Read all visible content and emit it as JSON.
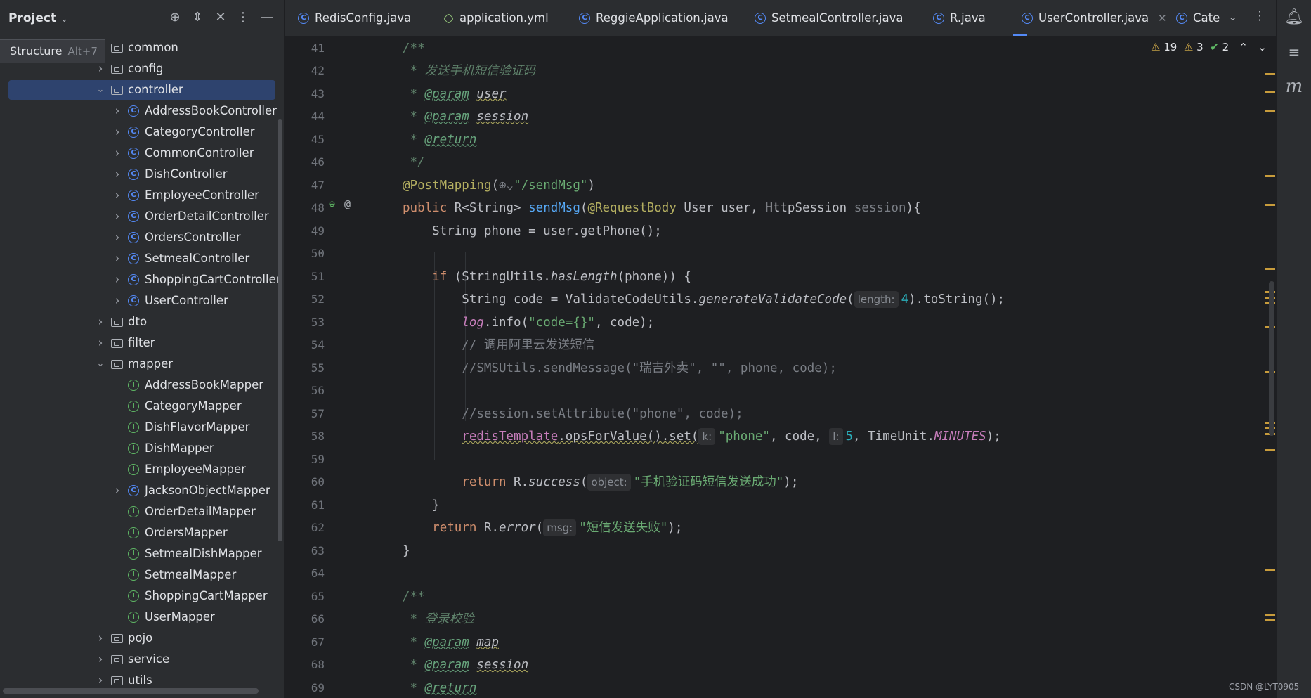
{
  "project_panel": {
    "title": "Project",
    "tooltip": {
      "label": "Structure",
      "shortcut": "Alt+7"
    },
    "tree": [
      {
        "label": "common",
        "icon": "folder-icon",
        "level": 1,
        "expander": ""
      },
      {
        "label": "config",
        "icon": "folder-icon",
        "level": 1,
        "expander": "collapsed"
      },
      {
        "label": "controller",
        "icon": "folder-icon",
        "level": 1,
        "expander": "expanded",
        "selected": true
      },
      {
        "label": "AddressBookController",
        "icon": "class-icon",
        "level": 2,
        "expander": "collapsed"
      },
      {
        "label": "CategoryController",
        "icon": "class-icon",
        "level": 2,
        "expander": "collapsed"
      },
      {
        "label": "CommonController",
        "icon": "class-icon",
        "level": 2,
        "expander": "collapsed"
      },
      {
        "label": "DishController",
        "icon": "class-icon",
        "level": 2,
        "expander": "collapsed"
      },
      {
        "label": "EmployeeController",
        "icon": "class-icon",
        "level": 2,
        "expander": "collapsed"
      },
      {
        "label": "OrderDetailController",
        "icon": "class-icon",
        "level": 2,
        "expander": "collapsed"
      },
      {
        "label": "OrdersController",
        "icon": "class-icon",
        "level": 2,
        "expander": "collapsed"
      },
      {
        "label": "SetmealController",
        "icon": "class-icon",
        "level": 2,
        "expander": "collapsed"
      },
      {
        "label": "ShoppingCartController",
        "icon": "class-icon",
        "level": 2,
        "expander": "collapsed"
      },
      {
        "label": "UserController",
        "icon": "class-icon",
        "level": 2,
        "expander": "collapsed"
      },
      {
        "label": "dto",
        "icon": "folder-icon",
        "level": 1,
        "expander": "collapsed"
      },
      {
        "label": "filter",
        "icon": "folder-icon",
        "level": 1,
        "expander": "collapsed"
      },
      {
        "label": "mapper",
        "icon": "folder-icon",
        "level": 1,
        "expander": "expanded"
      },
      {
        "label": "AddressBookMapper",
        "icon": "interface-icon",
        "level": 2,
        "expander": ""
      },
      {
        "label": "CategoryMapper",
        "icon": "interface-icon",
        "level": 2,
        "expander": ""
      },
      {
        "label": "DishFlavorMapper",
        "icon": "interface-icon",
        "level": 2,
        "expander": ""
      },
      {
        "label": "DishMapper",
        "icon": "interface-icon",
        "level": 2,
        "expander": ""
      },
      {
        "label": "EmployeeMapper",
        "icon": "interface-icon",
        "level": 2,
        "expander": ""
      },
      {
        "label": "JacksonObjectMapper",
        "icon": "class-icon",
        "level": 2,
        "expander": "collapsed"
      },
      {
        "label": "OrderDetailMapper",
        "icon": "interface-icon",
        "level": 2,
        "expander": ""
      },
      {
        "label": "OrdersMapper",
        "icon": "interface-icon",
        "level": 2,
        "expander": ""
      },
      {
        "label": "SetmealDishMapper",
        "icon": "interface-icon",
        "level": 2,
        "expander": ""
      },
      {
        "label": "SetmealMapper",
        "icon": "interface-icon",
        "level": 2,
        "expander": ""
      },
      {
        "label": "ShoppingCartMapper",
        "icon": "interface-icon",
        "level": 2,
        "expander": ""
      },
      {
        "label": "UserMapper",
        "icon": "interface-icon",
        "level": 2,
        "expander": ""
      },
      {
        "label": "pojo",
        "icon": "folder-icon",
        "level": 1,
        "expander": "collapsed"
      },
      {
        "label": "service",
        "icon": "folder-icon",
        "level": 1,
        "expander": "collapsed"
      },
      {
        "label": "utils",
        "icon": "folder-icon",
        "level": 1,
        "expander": "collapsed"
      }
    ]
  },
  "tabs": [
    {
      "label": "RedisConfig.java",
      "icon": "class-icon",
      "active": false
    },
    {
      "label": "application.yml",
      "icon": "yaml-icon",
      "active": false
    },
    {
      "label": "ReggieApplication.java",
      "icon": "class-icon",
      "active": false
    },
    {
      "label": "SetmealController.java",
      "icon": "class-icon",
      "active": false
    },
    {
      "label": "R.java",
      "icon": "class-icon",
      "active": false
    },
    {
      "label": "UserController.java",
      "icon": "class-icon",
      "active": true
    },
    {
      "label": "Cate",
      "icon": "class-icon",
      "active": false
    }
  ],
  "inspections": {
    "warnings": "19",
    "weak_warnings": "3",
    "ok": "2"
  },
  "code_lines": [
    {
      "n": "41",
      "html": "<span class='doc'>/**</span>"
    },
    {
      "n": "42",
      "html": "<span class='doc'> * 发送手机短信验证码</span>"
    },
    {
      "n": "43",
      "html": "<span class='doc'> * <span class='doctag'>@param</span> <span class='dparam'>user</span></span>"
    },
    {
      "n": "44",
      "html": "<span class='doc'> * <span class='doctag'>@param</span> <span class='dparam'>session</span></span>"
    },
    {
      "n": "45",
      "html": "<span class='doc'> * <span class='doctag'>@return</span></span>"
    },
    {
      "n": "46",
      "html": "<span class='doc'> */</span>"
    },
    {
      "n": "47",
      "html": "<span class='ann'>@PostMapping</span>(<span class='gray'>⊕⌄</span><span class='str'>\"/<u>sendMsg</u>\"</span>)"
    },
    {
      "n": "48",
      "html": "<span class='kw'>public</span> R&lt;String&gt; <span class='fn'>sendMsg</span>(<span class='ann'>@RequestBody</span> User user, HttpSession <span class='gray'>session</span>){"
    },
    {
      "n": "49",
      "html": "    String phone = user.getPhone();"
    },
    {
      "n": "50",
      "html": ""
    },
    {
      "n": "51",
      "html": "    <span class='kw'>if</span> (StringUtils.<span class='ital'>hasLength</span>(phone)) {"
    },
    {
      "n": "52",
      "html": "        String code = ValidateCodeUtils.<span class='ital'>generateValidateCode</span>(<span class='hint'>length:</span><span class='num'>4</span>).toString();"
    },
    {
      "n": "53",
      "html": "        <span class='field'>log</span>.info(<span class='str'>\"code={}\"</span>, code);"
    },
    {
      "n": "54",
      "html": "        <span class='cmt'>// 调用阿里云发送短信</span>"
    },
    {
      "n": "55",
      "html": "        <span class='cmt'><u>//</u>SMSUtils.sendMessage(\"瑞吉外卖\", \"\", phone, code);</span>"
    },
    {
      "n": "56",
      "html": ""
    },
    {
      "n": "57",
      "html": "        <span class='cmt'>//session.setAttribute(\"phone\", code);</span>"
    },
    {
      "n": "58",
      "html": "        <span class='field wavy' style='font-style:normal'>redisTemplate</span><span class='wavy'>.opsForValue().set(</span><span class='hint'>k:</span><span class='str'>\"phone\"</span>, code, <span class='hint'>l:</span><span class='num'>5</span>, TimeUnit.<span class='field'>MINUTES</span>);"
    },
    {
      "n": "59",
      "html": ""
    },
    {
      "n": "60",
      "html": "        <span class='kw'>return</span> R.<span class='ital'>success</span>(<span class='hint'>object:</span><span class='str'>\"手机验证码短信发送成功\"</span>);"
    },
    {
      "n": "61",
      "html": "    }"
    },
    {
      "n": "62",
      "html": "    <span class='kw'>return</span> R.<span class='ital'>error</span>(<span class='hint'>msg:</span><span class='str'>\"短信发送失败\"</span>);"
    },
    {
      "n": "63",
      "html": "}"
    },
    {
      "n": "64",
      "html": ""
    },
    {
      "n": "65",
      "html": "<span class='doc'>/**</span>"
    },
    {
      "n": "66",
      "html": "<span class='doc'> * 登录校验</span>"
    },
    {
      "n": "67",
      "html": "<span class='doc'> * <span class='doctag'>@param</span> <span class='dparam'>map</span></span>"
    },
    {
      "n": "68",
      "html": "<span class='doc'> * <span class='doctag'>@param</span> <span class='dparam'>session</span></span>"
    },
    {
      "n": "69",
      "html": "<span class='doc'> * <span class='doctag'>@return</span></span>"
    }
  ],
  "watermark": "CSDN @LYT0905",
  "colors": {
    "accent": "#548af7",
    "selection": "#2e436e",
    "warning": "#e0b64c",
    "ok": "#5fb865"
  }
}
